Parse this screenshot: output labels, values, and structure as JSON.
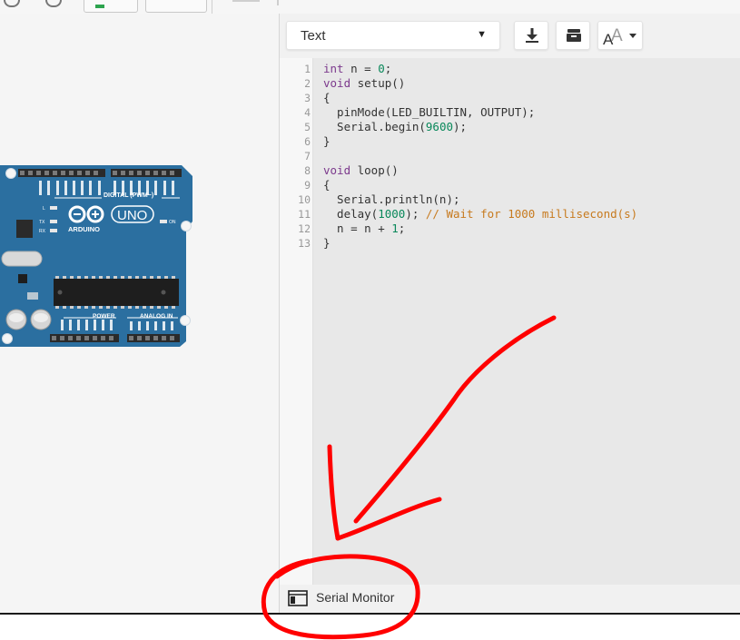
{
  "code_panel": {
    "mode_dropdown": {
      "selected": "Text"
    },
    "buttons": {
      "download_icon": "download-icon",
      "library_icon": "library-icon",
      "font_size_icon": "font-size-icon"
    }
  },
  "editor": {
    "line_numbers": [
      "1",
      "2",
      "3",
      "4",
      "5",
      "6",
      "7",
      "8",
      "9",
      "10",
      "11",
      "12",
      "13"
    ]
  },
  "board": {
    "name": "ARDUINO",
    "model": "UNO",
    "label_digital": "DIGITAL (PWM~)",
    "label_power": "POWER",
    "label_analog": "ANALOG IN",
    "label_on": "ON",
    "label_tx": "TX",
    "label_rx": "RX",
    "label_l": "L"
  },
  "bottom": {
    "serial_monitor_label": "Serial Monitor"
  },
  "colors": {
    "board_blue": "#2b6fa0",
    "annotation_red": "#ff0000",
    "keyword": "#7c3a8d",
    "number": "#09885a",
    "comment": "#c77a1e"
  }
}
